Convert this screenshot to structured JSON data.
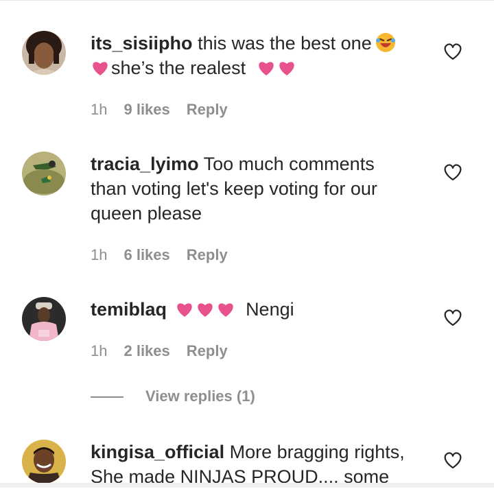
{
  "comments": [
    {
      "username": "its_sisiipho",
      "text_a": "this was the best one",
      "text_b": "she’s the realest",
      "time": "1h",
      "likes": "9 likes",
      "reply": "Reply"
    },
    {
      "username": "tracia_lyimo",
      "text": "Too much comments than voting let's keep voting for our queen please",
      "time": "1h",
      "likes": "6 likes",
      "reply": "Reply"
    },
    {
      "username": "temiblaq",
      "text": "Nengi",
      "time": "1h",
      "likes": "2 likes",
      "reply": "Reply",
      "view_replies": "View replies (1)"
    },
    {
      "username": "kingisa_official",
      "text": "More bragging rights, She made NINJAS PROUD.... some"
    }
  ],
  "icons": {
    "like": "heart-outline-icon",
    "emoji_heart": "pink-heart-emoji",
    "emoji_laugh": "laughing-face-emoji"
  },
  "colors": {
    "text": "#262626",
    "meta": "#8e8e8e",
    "heart_emoji": "#e8528c"
  }
}
